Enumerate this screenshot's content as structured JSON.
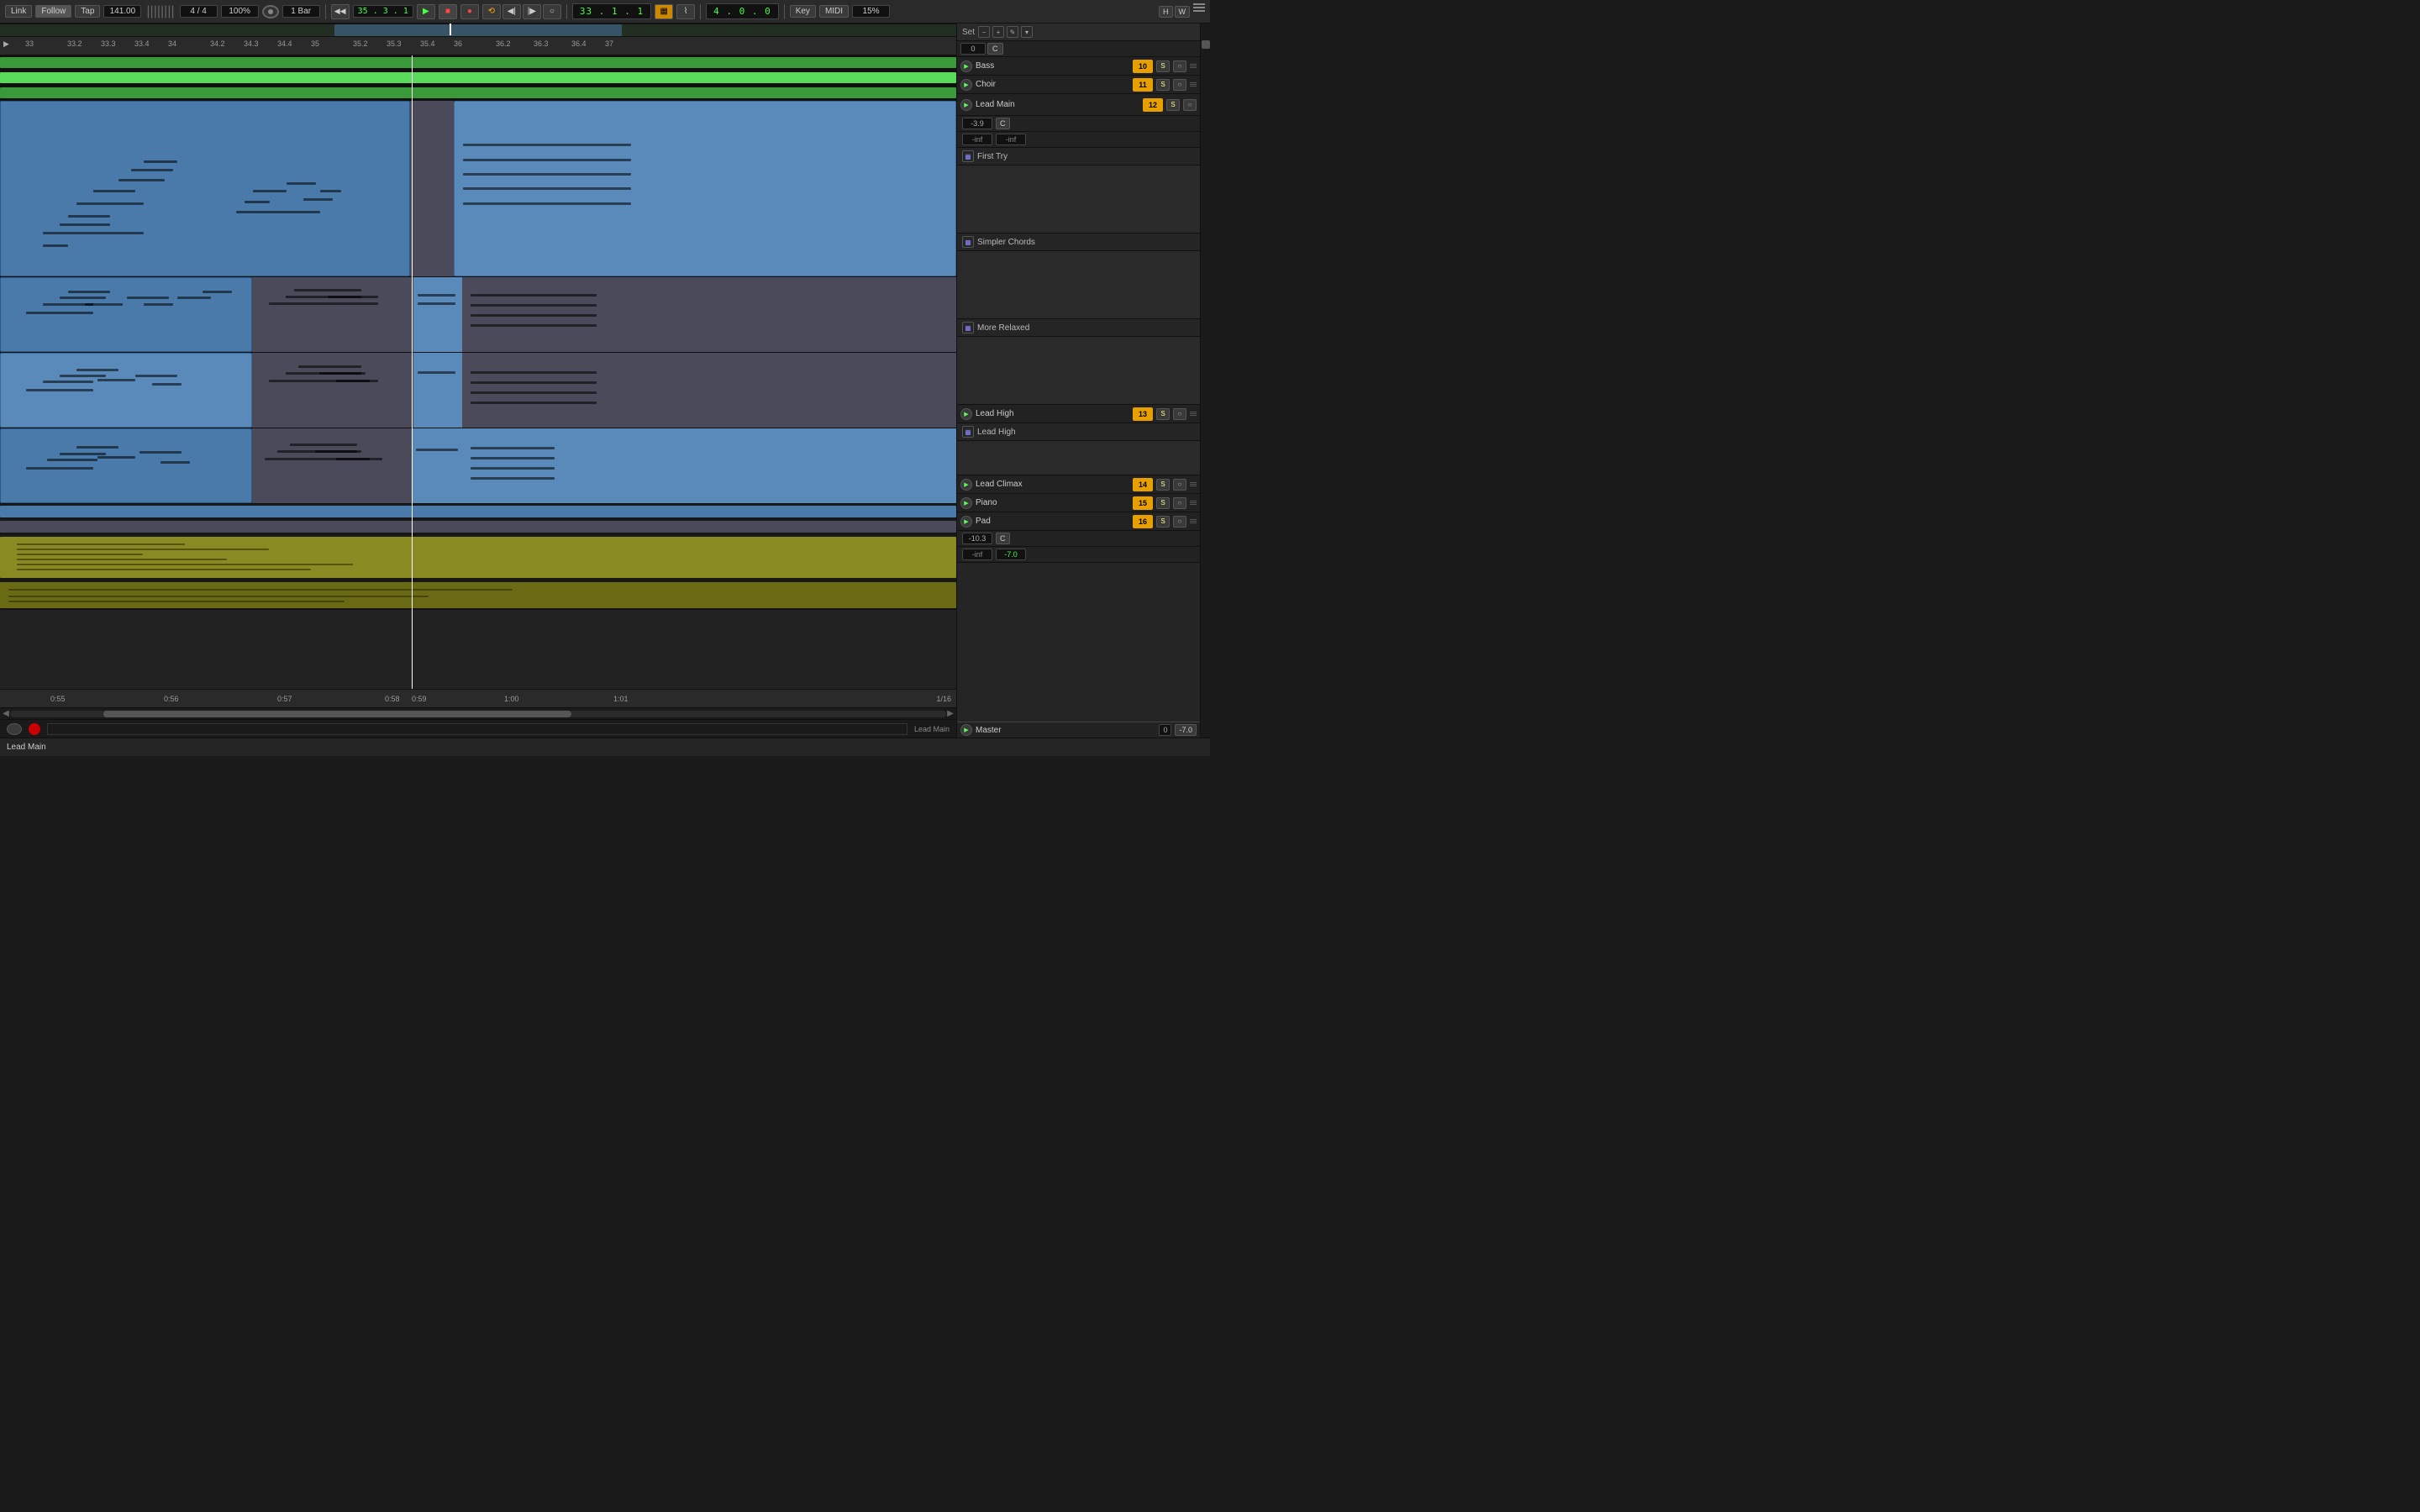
{
  "toolbar": {
    "link_label": "Link",
    "follow_label": "Follow",
    "tap_label": "Tap",
    "bpm": "141.00",
    "time_sig": "4 / 4",
    "zoom": "100%",
    "quantize": "1 Bar",
    "position": "35 . 3 . 1",
    "time_display": "33 . 1 . 1",
    "time_secondary": "4 . 0 . 0",
    "key_label": "Key",
    "midi_label": "MIDI",
    "scale_pct": "15%"
  },
  "tracks": [
    {
      "id": "bass",
      "name": "Bass",
      "number": "10",
      "color": "#e8a000",
      "type": "audio"
    },
    {
      "id": "choir",
      "name": "Choir",
      "number": "11",
      "color": "#e8a000",
      "type": "audio"
    },
    {
      "id": "lead-main",
      "name": "Lead Main",
      "number": "12",
      "color": "#e8a000",
      "type": "midi"
    },
    {
      "id": "lead-high",
      "name": "Lead High",
      "number": "13",
      "color": "#e8a000",
      "type": "midi"
    },
    {
      "id": "lead-climax",
      "name": "Lead Climax",
      "number": "14",
      "color": "#e8a000",
      "type": "midi"
    },
    {
      "id": "piano",
      "name": "Piano",
      "number": "15",
      "color": "#e8a000",
      "type": "midi"
    },
    {
      "id": "pad",
      "name": "Pad",
      "number": "16",
      "color": "#e8a000",
      "type": "midi"
    }
  ],
  "clips": {
    "first_try": "First Try",
    "simpler_chords": "Simpler Chords",
    "more_relaxed": "More Relaxed",
    "lead_high": "Lead High"
  },
  "meters": {
    "lead_main_vol": "-3.9",
    "lead_main_inf1": "-inf",
    "lead_main_inf2": "-inf",
    "pad_vol": "-10.3",
    "pad_inf1": "-inf",
    "pad_inf2": "-7.0",
    "master_vol": "0"
  },
  "ruler": {
    "marks": [
      "33",
      "33.2",
      "33.3",
      "33.4",
      "34",
      "34.2",
      "34.3",
      "34.4",
      "35",
      "35.2",
      "35.3",
      "35.4",
      "36",
      "36.2",
      "36.3",
      "36.4",
      "37"
    ]
  },
  "bottom_timeline": {
    "marks": [
      "0:55",
      "0:56",
      "0:57",
      "0:58",
      "0:59",
      "1:00",
      "1:01"
    ]
  },
  "status": {
    "quantize": "1/16",
    "label": "Lead Main"
  },
  "set_label": "Set"
}
